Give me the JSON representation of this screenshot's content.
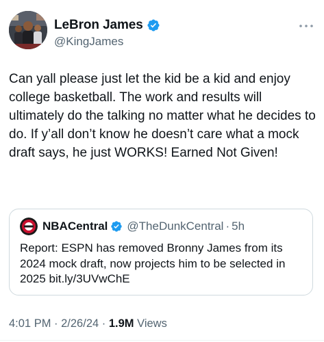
{
  "author": {
    "display_name": "LeBron James",
    "handle": "@KingJames",
    "verified": true
  },
  "tweet": {
    "text": "Can yall please just let the kid be a kid and enjoy college basketball. The work and results will ultimately do the talking no matter what he decides to do. If y’all don’t know he doesn’t care what a mock draft says, he just WORKS! Earned Not Given!"
  },
  "quoted": {
    "display_name": "NBACentral",
    "handle": "@TheDunkCentral",
    "separator": "·",
    "time": "5h",
    "text": "Report: ESPN has removed Bronny James from its 2024 mock draft, now projects him to be selected in 2025 bit.ly/3UVwChE"
  },
  "meta": {
    "time": "4:01 PM",
    "sep1": " · ",
    "date": "2/26/24",
    "sep2": " · ",
    "views_count": "1.9M",
    "views_label": " Views"
  },
  "colors": {
    "verified": "#1d9bf0",
    "text": "#0f1419",
    "secondary": "#536471",
    "border": "#cfd9de"
  },
  "icons": [
    "verified-badge-icon",
    "more-options-icon"
  ]
}
